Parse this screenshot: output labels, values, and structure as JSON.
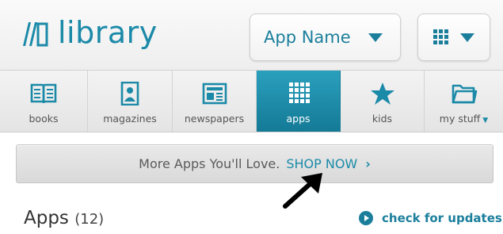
{
  "header": {
    "brand_text": "library",
    "selector_label": "App Name"
  },
  "nav": {
    "items": [
      {
        "label": "books",
        "icon": "book-icon"
      },
      {
        "label": "magazines",
        "icon": "magazine-icon"
      },
      {
        "label": "newspapers",
        "icon": "newspaper-icon"
      },
      {
        "label": "apps",
        "icon": "apps-grid-icon",
        "active": true
      },
      {
        "label": "kids",
        "icon": "star-icon"
      },
      {
        "label": "my stuff",
        "icon": "folder-icon"
      }
    ]
  },
  "banner": {
    "text": "More Apps You'll Love.",
    "link_label": "SHOP NOW",
    "link_chevron": "›"
  },
  "section": {
    "title": "Apps",
    "count": "(12)",
    "updates_label": "check for updates"
  },
  "colors": {
    "accent": "#1b8aa8",
    "active_tab": "#1a8aa6"
  }
}
